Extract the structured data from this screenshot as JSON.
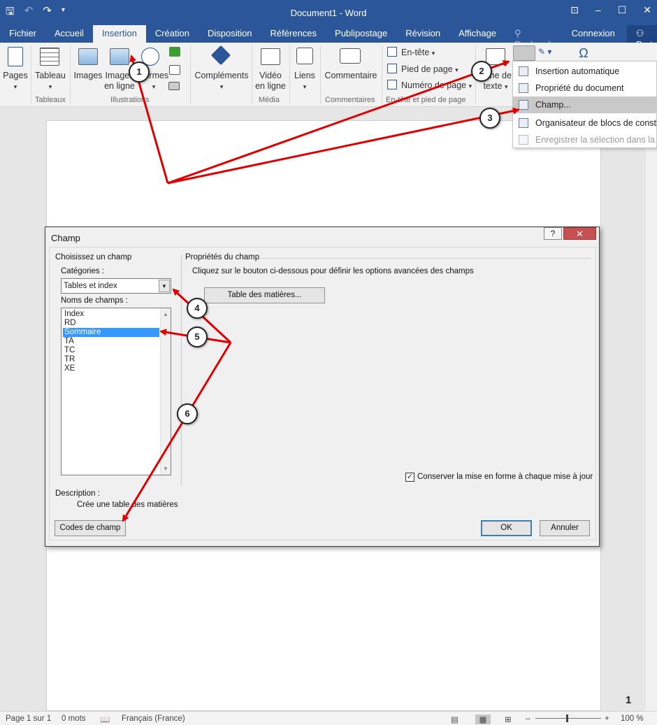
{
  "window": {
    "title": "Document1 - Word"
  },
  "tabs": [
    "Fichier",
    "Accueil",
    "Insertion",
    "Création",
    "Disposition",
    "Références",
    "Publipostage",
    "Révision",
    "Affichage",
    "Recherch",
    "Connexion",
    "Partager"
  ],
  "active_tab": "Insertion",
  "ribbon": {
    "pages": "Pages",
    "tableau": "Tableau",
    "tableaux_group": "Tableaux",
    "images": "Images",
    "images_en_ligne_1": "Images",
    "images_en_ligne_2": "en ligne",
    "formes": "Formes",
    "illustrations_group": "Illustrations",
    "complements": "Compléments",
    "video_1": "Vidéo",
    "video_2": "en ligne",
    "media_group": "Média",
    "liens": "Liens",
    "commentaire": "Commentaire",
    "commentaires_group": "Commentaires",
    "entete": "En-tête",
    "pied_de_page": "Pied de page",
    "numero_de_page": "Numéro de page",
    "hf_group": "En-tête et pied de page",
    "zone_1": "Zone de",
    "zone_2": "texte",
    "symbol": "Ω"
  },
  "dropdown": {
    "items": [
      {
        "label": "Insertion automatique",
        "state": "normal"
      },
      {
        "label": "Propriété du document",
        "state": "normal"
      },
      {
        "label": "Champ...",
        "state": "highlighted"
      },
      {
        "label": "Organisateur de blocs de construction...",
        "state": "normal"
      },
      {
        "label": "Enregistrer la sélection dans la galerie de composants QuickPart...",
        "state": "disabled"
      }
    ]
  },
  "dialog": {
    "title": "Champ",
    "help": "?",
    "close": "✕",
    "choose_field": "Choisissez un champ",
    "categories_label": "Catégories :",
    "category_value": "Tables et index",
    "field_names_label": "Noms de champs :",
    "fields": [
      "Index",
      "RD",
      "Sommaire",
      "TA",
      "TC",
      "TR",
      "XE"
    ],
    "selected_field": "Sommaire",
    "properties_label": "Propriétés du champ",
    "properties_hint": "Cliquez sur le bouton ci-dessous pour définir les options avancées des champs",
    "toc_button": "Table des matières...",
    "preserve_label": "Conserver la mise en forme à chaque mise à jour",
    "preserve_checked": true,
    "description_label": "Description :",
    "description_text": "Crée une table des matières",
    "field_codes_button": "Codes de champ",
    "ok_button": "OK",
    "cancel_button": "Annuler"
  },
  "status": {
    "page": "Page 1 sur 1",
    "words": "0 mots",
    "language": "Français (France)",
    "zoom": "100 %"
  },
  "document": {
    "page_number": "1"
  },
  "annotations": [
    "1",
    "2",
    "3",
    "4",
    "5",
    "6"
  ],
  "colors": {
    "accent": "#2b579a",
    "arrow": "#e00000",
    "selection": "#3399ff"
  }
}
